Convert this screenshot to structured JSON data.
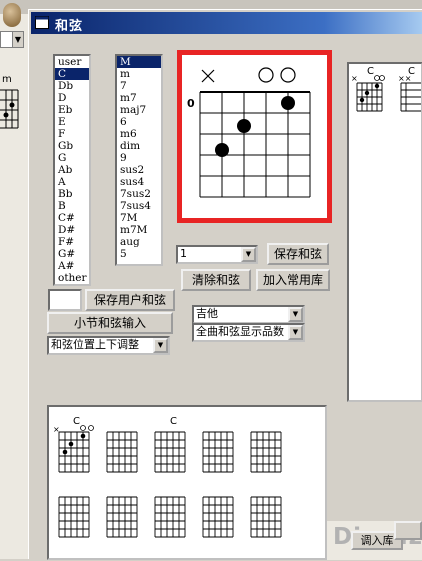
{
  "window": {
    "title": "和弦"
  },
  "root_list": [
    "user",
    "C",
    "Db",
    "D",
    "Eb",
    "E",
    "F",
    "Gb",
    "G",
    "Ab",
    "A",
    "Bb",
    "B",
    "C#",
    "D#",
    "F#",
    "G#",
    "A#",
    "other"
  ],
  "root_selected": 1,
  "type_list": [
    "M",
    "m",
    "7",
    "m7",
    "maj7",
    "6",
    "m6",
    "dim",
    "9",
    "sus2",
    "sus4",
    "7sus2",
    "7sus4",
    "7M",
    "m7M",
    "aug",
    "5"
  ],
  "type_selected": 0,
  "diagram": {
    "fret_label": "0",
    "open_mark": "×",
    "string_states": [
      "x",
      "",
      "",
      "",
      "o",
      "o"
    ]
  },
  "controls": {
    "fret_select": "1",
    "save_chord": "保存和弦",
    "clear_chord": "清除和弦",
    "add_common": "加入常用库",
    "save_user_chord": "保存用户和弦",
    "measure_input": "小节和弦输入",
    "position_adjust": "和弦位置上下调整",
    "instrument": "吉他",
    "display_mode": "全曲和弦显示品数"
  },
  "bottom_chords": {
    "first_label": "C",
    "second_label": "C"
  },
  "right_chords": {
    "first_label": "C",
    "second_label": "C"
  },
  "background": {
    "fragment_label": "m"
  },
  "footer": {
    "import_button": "调入库",
    "watermark": "Discuz!"
  },
  "colors": {
    "title_start": "#0a246a",
    "title_end": "#a6caf0",
    "selection": "#0a246a",
    "highlight_border": "#e82424"
  }
}
